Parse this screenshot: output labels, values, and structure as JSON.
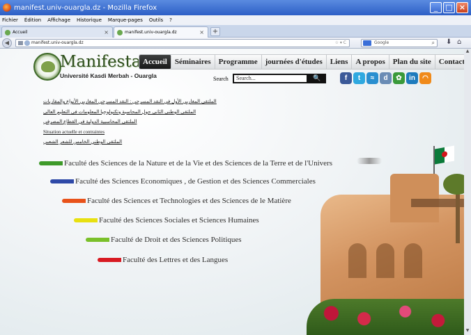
{
  "window": {
    "title": "manifest.univ-ouargla.dz - Mozilla Firefox"
  },
  "menubar": [
    "Fichier",
    "Édition",
    "Affichage",
    "Historique",
    "Marque-pages",
    "Outils",
    "?"
  ],
  "tabs": [
    {
      "label": "Accueil"
    },
    {
      "label": "manifest.univ-ouargla.dz"
    }
  ],
  "urlbar": {
    "url": "manifest.univ-ouargla.dz"
  },
  "searchbar": {
    "placeholder": "Google"
  },
  "site": {
    "logo_title": "Manifestations",
    "logo_subtitle": "Université Kasdi Merbah - Ouargla",
    "menu": [
      "Accueil",
      "Séminaires",
      "Programme",
      "journées d'études",
      "Liens",
      "A propos",
      "Plan du site",
      "Contact"
    ],
    "search_label": "Search",
    "search_placeholder": "Search...",
    "search_button": "🔍",
    "social": [
      {
        "name": "facebook",
        "glyph": "f",
        "color": "#3b5998"
      },
      {
        "name": "twitter",
        "glyph": "t",
        "color": "#2fa9e0"
      },
      {
        "name": "rss",
        "glyph": "≈",
        "color": "#2a8fd0"
      },
      {
        "name": "digg",
        "glyph": "d",
        "color": "#6a8cb5"
      },
      {
        "name": "delicious",
        "glyph": "✿",
        "color": "#3a9a3a"
      },
      {
        "name": "linkedin",
        "glyph": "in",
        "color": "#1e7bbd"
      },
      {
        "name": "rss-feed",
        "glyph": "◠",
        "color": "#f08a1a"
      }
    ],
    "links": [
      "الملتقى المغاربي الأول في النقد المسرحي : النقد المسرحي المغاربي الأنواع والمقاربات",
      "الملتقى الوطني الثاني حول المحاسبة وتكنولوجيا المعلومات في التعليم العالي",
      "الملتقى  المحاسبية الدولية في القطاع المصرفي",
      "Situation actuelle et contraintes",
      "الملتقى الوطني الخامس للشعر الشعبي"
    ],
    "faculties": [
      {
        "label": "Faculté des Sciences de la Nature et de la Vie et des Sciences de la Terre et de l'Univers",
        "color": "#3e9a2a"
      },
      {
        "label": "Faculté des Sciences Economiques , de Gestion et des Sciences Commerciales",
        "color": "#2f4aa8"
      },
      {
        "label": "Faculté des Sciences et Technologies et des Sciences de le Matière",
        "color": "#e8521a"
      },
      {
        "label": "Faculté des Sciences Sociales et Sciences Humaines",
        "color": "#e8e010"
      },
      {
        "label": "Faculté de Droit et des Sciences Politiques",
        "color": "#7ac02a"
      },
      {
        "label": "Faculté des Lettres et des Langues",
        "color": "#d81a22"
      }
    ]
  }
}
